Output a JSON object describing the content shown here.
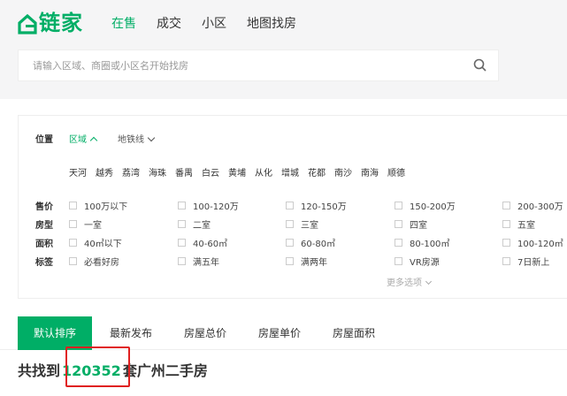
{
  "brand": {
    "name": "链家",
    "color": "#00ae66"
  },
  "nav": [
    {
      "label": "在售",
      "active": true
    },
    {
      "label": "成交",
      "active": false
    },
    {
      "label": "小区",
      "active": false
    },
    {
      "label": "地图找房",
      "active": false
    }
  ],
  "search": {
    "placeholder": "请输入区域、商圈或小区名开始找房",
    "icon": "search-icon"
  },
  "filter": {
    "position_label": "位置",
    "position_tabs": [
      {
        "label": "区域",
        "active": true,
        "icon": "chevron-up-icon"
      },
      {
        "label": "地铁线",
        "active": false,
        "icon": "chevron-down-icon"
      }
    ],
    "districts": [
      "天河",
      "越秀",
      "荔湾",
      "海珠",
      "番禺",
      "白云",
      "黄埔",
      "从化",
      "增城",
      "花都",
      "南沙",
      "南海",
      "顺德"
    ],
    "rows": [
      {
        "label": "售价",
        "options": [
          "100万以下",
          "100-120万",
          "120-150万",
          "150-200万",
          "200-300万"
        ]
      },
      {
        "label": "房型",
        "options": [
          "一室",
          "二室",
          "三室",
          "四室",
          "五室"
        ]
      },
      {
        "label": "面积",
        "options": [
          "40㎡以下",
          "40-60㎡",
          "60-80㎡",
          "80-100㎡",
          "100-120㎡"
        ]
      },
      {
        "label": "标签",
        "options": [
          "必看好房",
          "满五年",
          "满两年",
          "VR房源",
          "7日新上"
        ]
      }
    ],
    "more_label": "更多选项"
  },
  "sort_tabs": [
    {
      "label": "默认排序",
      "active": true
    },
    {
      "label": "最新发布",
      "active": false
    },
    {
      "label": "房屋总价",
      "active": false
    },
    {
      "label": "房屋单价",
      "active": false
    },
    {
      "label": "房屋面积",
      "active": false
    }
  ],
  "result": {
    "prefix": "共找到",
    "count": "120352",
    "suffix": "套广州二手房"
  },
  "highlight_color": "#e02020"
}
